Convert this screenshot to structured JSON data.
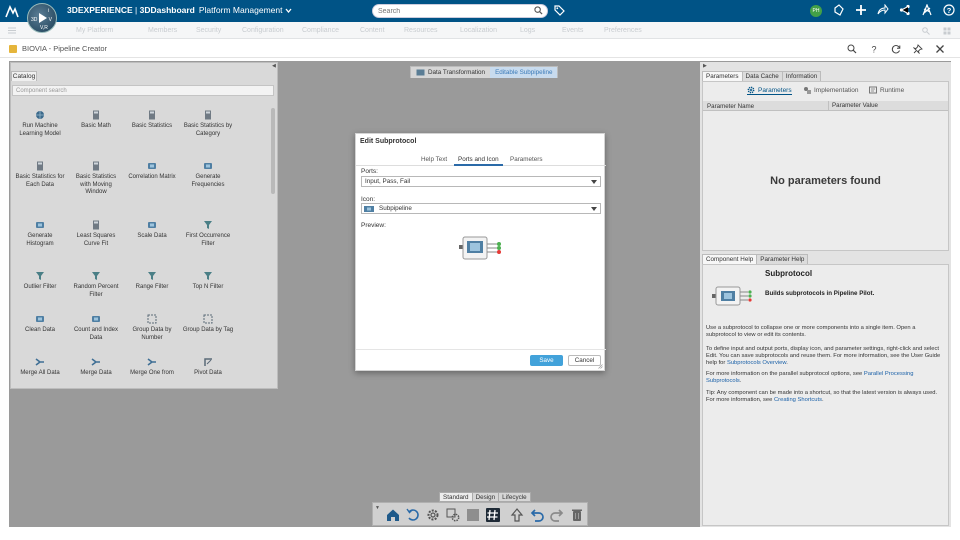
{
  "topbar": {
    "brand_main": "3DEXPERIENCE",
    "brand_sep": " | ",
    "brand_app": "3DDashboard",
    "brand_platform": "Platform Management",
    "compass_version": "V,R",
    "search_placeholder": "Search",
    "avatar_initials": "PH"
  },
  "subbar": {
    "items": [
      "My Platform",
      "Members",
      "Security",
      "Configuration",
      "Compliance",
      "Content",
      "Resources",
      "Localization",
      "Logs",
      "Events",
      "Preferences"
    ]
  },
  "app": {
    "title": "BIOVIA - Pipeline Creator"
  },
  "catalog": {
    "tab": "Catalog",
    "search_placeholder": "Component search",
    "items": [
      "Run Machine Learning Model",
      "Basic Math",
      "Basic Statistics",
      "Basic Statistics by Category",
      "Basic Statistics for Each Data",
      "Basic Statistics with Moving Window",
      "Correlation Matrix",
      "Generate Frequencies",
      "Generate Histogram",
      "Least Squares Curve Fit",
      "Scale Data",
      "First Occurrence Filter",
      "Outlier Filter",
      "Random Percent Filter",
      "Range Filter",
      "Top N Filter",
      "Clean Data",
      "Count and Index Data",
      "Group Data by Number",
      "Group Data by Tag",
      "Merge All Data",
      "Merge Data",
      "Merge One from",
      "Pivot Data"
    ]
  },
  "canvas": {
    "btn_data_transformation": "Data Transformation",
    "btn_editable_subpipeline": "Editable Subpipeline"
  },
  "right_panel": {
    "tabs": [
      "Parameters",
      "Data Cache",
      "Information"
    ],
    "subtabs": [
      "Parameters",
      "Implementation",
      "Runtime"
    ],
    "col_name": "Parameter Name",
    "col_value": "Parameter Value",
    "empty_text": "No parameters found",
    "help_tabs": [
      "Component Help",
      "Parameter Help"
    ],
    "help_title": "Subprotocol",
    "help_subtitle": "Builds subprotocols in Pipeline Pilot.",
    "help_p1": "Use a subprotocol to collapse one or more components into a single item. Open a subprotocol to view or edit its contents.",
    "help_p2_pre": "To define input and output ports, display icon, and parameter settings, right-click and select Edit. You can save subprotocols and reuse them. For more information, see the User Guide help for ",
    "help_p2_link": "Subprotocols Overview",
    "help_p3_pre": "For more information on the parallel subprotocol options, see ",
    "help_p3_link": "Parallel Processing Subprotocols",
    "help_p4_pre": "Tip: Any component can be made into a shortcut, so that the latest version is always used. For more information, see ",
    "help_p4_link": "Creating Shortcuts"
  },
  "dialog": {
    "title": "Edit Subprotocol",
    "tabs": [
      "Help Text",
      "Ports and Icon",
      "Parameters"
    ],
    "active_tab": "Ports and Icon",
    "ports_label": "Ports:",
    "ports_value": "Input, Pass, Fail",
    "icon_label": "Icon:",
    "icon_value": "Subpipeline",
    "preview_label": "Preview:",
    "save": "Save",
    "cancel": "Cancel"
  },
  "bottom": {
    "mode_tabs": [
      "Standard",
      "Design",
      "Lifecycle"
    ]
  },
  "colors": {
    "topbar": "#005386",
    "accent_button": "#42a2da",
    "workspace": "#9a9a9a",
    "link": "#1b61a8"
  }
}
